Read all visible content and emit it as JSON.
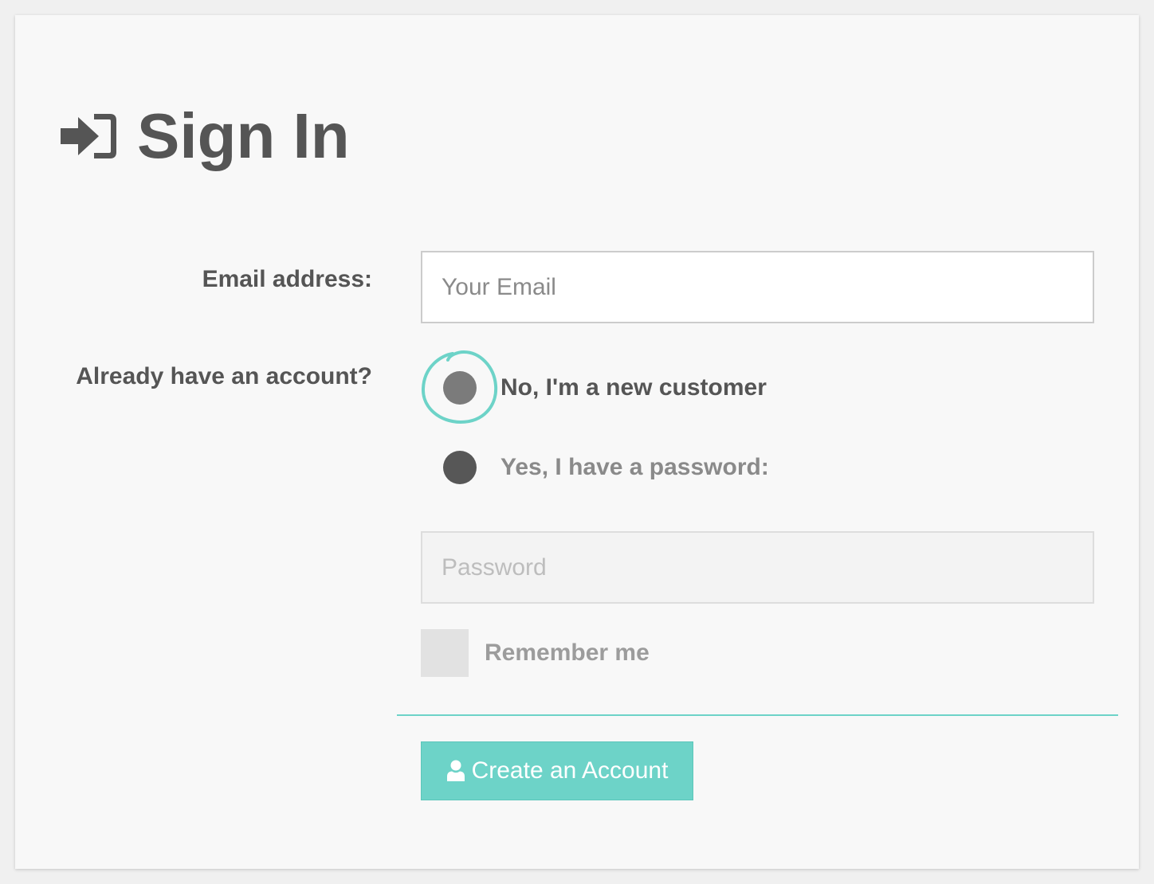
{
  "header": {
    "title": "Sign In",
    "icon": "sign-in-icon"
  },
  "form": {
    "email_label": "Email address:",
    "email_placeholder": "Your Email",
    "email_value": "",
    "account_label": "Already have an account?",
    "options": [
      {
        "label": "No, I'm a new customer",
        "selected": true
      },
      {
        "label": "Yes, I have a password:",
        "selected": false
      }
    ],
    "password_placeholder": "Password",
    "password_value": "",
    "remember_label": "Remember me",
    "remember_checked": false
  },
  "actions": {
    "create_label": "Create an Account",
    "create_icon": "user-icon"
  },
  "colors": {
    "accent": "#6dd3c8",
    "text": "#555555",
    "background": "#f8f8f8"
  }
}
